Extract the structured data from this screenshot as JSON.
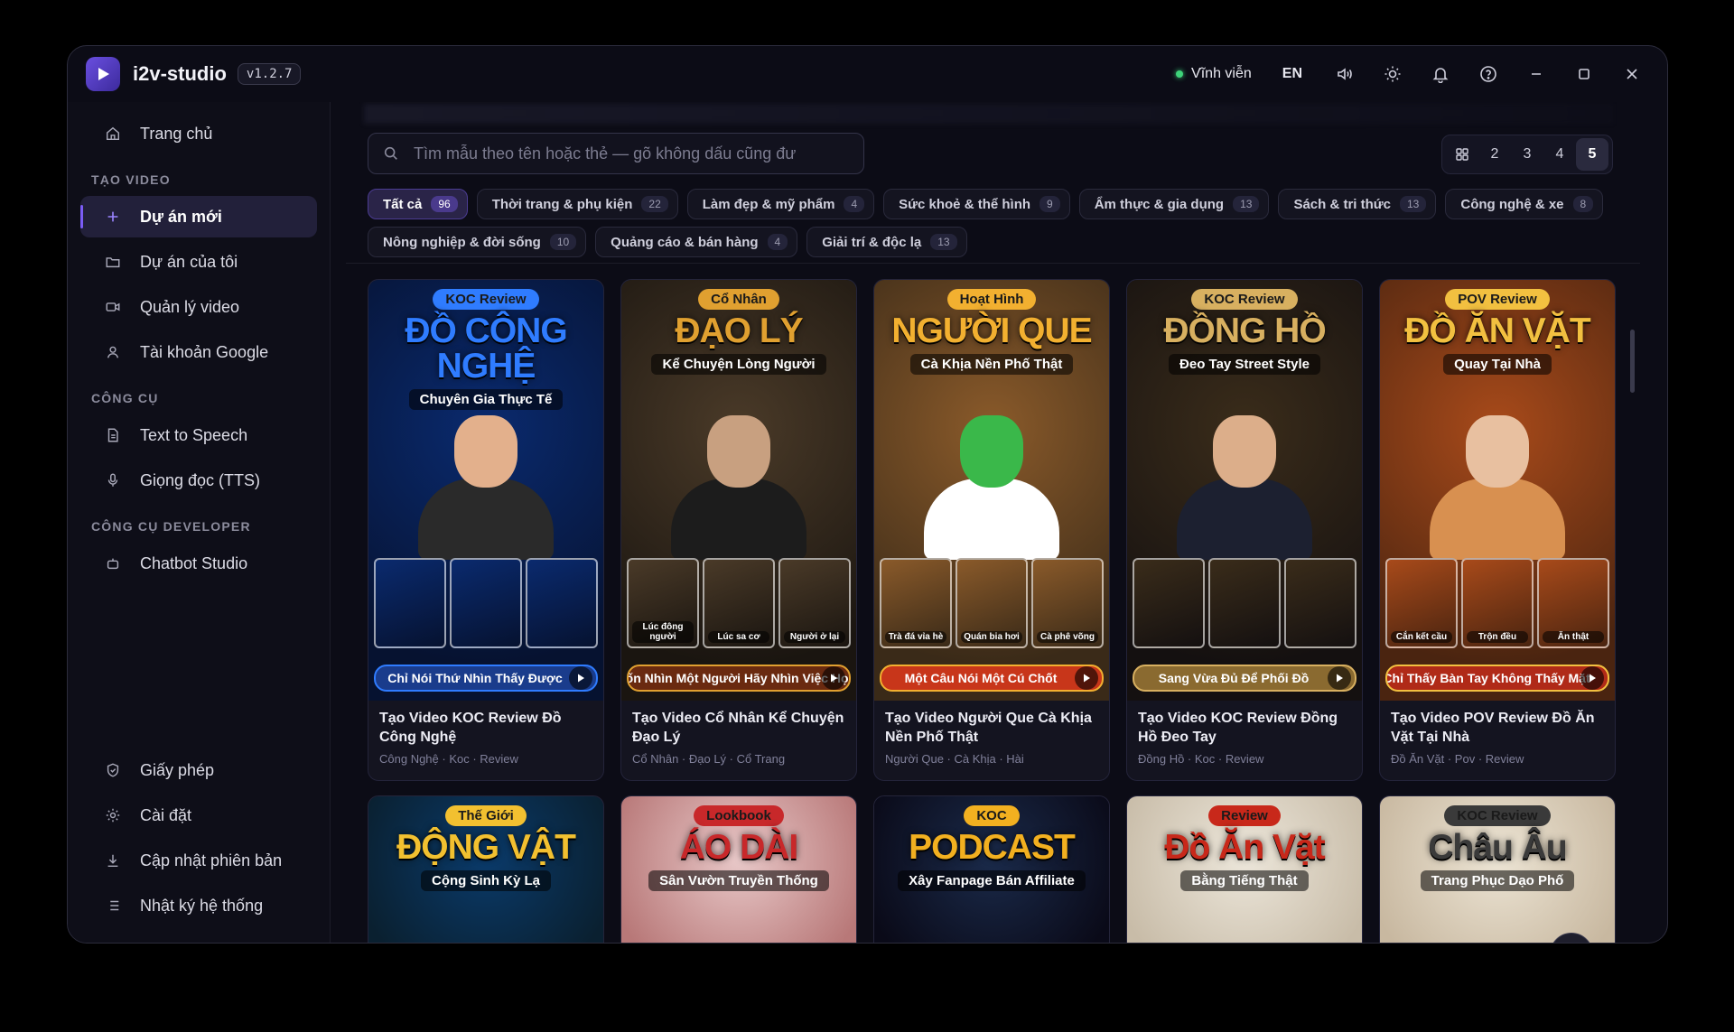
{
  "app": {
    "name": "i2v-studio",
    "version": "v1.2.7"
  },
  "titlebar": {
    "status": "Vĩnh viễn",
    "language": "EN"
  },
  "sidebar": {
    "home": "Trang chủ",
    "section_create": "TẠO VIDEO",
    "new_project": "Dự án mới",
    "my_projects": "Dự án của tôi",
    "video_manager": "Quản lý video",
    "google_account": "Tài khoản Google",
    "section_tools": "CÔNG CỤ",
    "tts": "Text to Speech",
    "voices": "Giọng đọc (TTS)",
    "section_dev": "CÔNG CỤ DEVELOPER",
    "chatbot": "Chatbot Studio",
    "license": "Giấy phép",
    "settings": "Cài đặt",
    "update": "Cập nhật phiên bản",
    "logs": "Nhật ký hệ thống"
  },
  "search": {
    "placeholder": "Tìm mẫu theo tên hoặc thẻ — gõ không dấu cũng đư"
  },
  "columns": {
    "options": [
      "2",
      "3",
      "4",
      "5"
    ],
    "selected": "5"
  },
  "filters": [
    {
      "label": "Tất cả",
      "count": "96"
    },
    {
      "label": "Thời trang & phụ kiện",
      "count": "22"
    },
    {
      "label": "Làm đẹp & mỹ phẩm",
      "count": "4"
    },
    {
      "label": "Sức khoẻ & thể hình",
      "count": "9"
    },
    {
      "label": "Ẩm thực & gia dụng",
      "count": "13"
    },
    {
      "label": "Sách & tri thức",
      "count": "13"
    },
    {
      "label": "Công nghệ & xe",
      "count": "8"
    },
    {
      "label": "Nông nghiệp & đời sống",
      "count": "10"
    },
    {
      "label": "Quảng cáo & bán hàng",
      "count": "4"
    },
    {
      "label": "Giải trí & độc lạ",
      "count": "13"
    }
  ],
  "cards": [
    {
      "title": "Tạo Video KOC Review Đồ Công Nghệ",
      "meta": "Công Nghệ · Koc · Review",
      "tag": "KOC Review",
      "big": "ĐỒ CÔNG NGHỆ",
      "sub": "Chuyên Gia Thực Tế",
      "cells": [
        "",
        "",
        ""
      ],
      "banner": "Chỉ Nói Thứ Nhìn Thấy Được",
      "colors": {
        "bg1": "#0a2a6e",
        "bg2": "#061230",
        "accent": "#2f7cff",
        "skin": "#e3b08c",
        "shirt": "#2a2a2a",
        "banner": "#1a3c8c"
      }
    },
    {
      "title": "Tạo Video Cổ Nhân Kể Chuyện Đạo Lý",
      "meta": "Cổ Nhân · Đạo Lý · Cổ Trang",
      "tag": "Cổ Nhân",
      "big": "ĐẠO LÝ",
      "sub": "Kể Chuyện Lòng Người",
      "cells": [
        "Lúc đông người",
        "Lúc sa cơ",
        "Người ở lại"
      ],
      "banner": "Muốn Nhìn Một Người Hãy Nhìn Việc Họ",
      "colors": {
        "bg1": "#4a3a28",
        "bg2": "#1a1510",
        "accent": "#e0a030",
        "skin": "#c8a080",
        "shirt": "#1c1c1c",
        "banner": "#6a2a10"
      }
    },
    {
      "title": "Tạo Video Người Que Cà Khịa Nền Phố Thật",
      "meta": "Người Que · Cà Khịa · Hài",
      "tag": "Hoạt Hình",
      "big": "NGƯỜI QUE",
      "sub": "Cà Khịa Nền Phố Thật",
      "cells": [
        "Trà đá vỉa hè",
        "Quán bia hơi",
        "Cà phê võng"
      ],
      "banner": "Một Câu Nói Một Cú Chốt",
      "colors": {
        "bg1": "#8a5a2a",
        "bg2": "#3a2a18",
        "accent": "#f2b030",
        "skin": "#3ab84a",
        "shirt": "#ffffff",
        "banner": "#c8361a"
      }
    },
    {
      "title": "Tạo Video KOC Review Đồng Hồ Đeo Tay",
      "meta": "Đồng Hồ · Koc · Review",
      "tag": "KOC Review",
      "big": "ĐỒNG HỒ",
      "sub": "Đeo Tay Street Style",
      "cells": [
        "",
        "",
        ""
      ],
      "banner": "Sang Vừa Đủ Để Phối Đồ",
      "colors": {
        "bg1": "#3a2c1a",
        "bg2": "#141010",
        "accent": "#d8b060",
        "skin": "#dcae8a",
        "shirt": "#1c2030",
        "banner": "#8a6a30"
      }
    },
    {
      "title": "Tạo Video POV Review Đồ Ăn Vặt Tại Nhà",
      "meta": "Đồ Ăn Vặt · Pov · Review",
      "tag": "POV Review",
      "big": "ĐỒ ĂN VẶT",
      "sub": "Quay Tại Nhà",
      "cells": [
        "Cắn kết cầu",
        "Trộn đều",
        "Ăn thật"
      ],
      "banner": "Chỉ Thấy Bàn Tay Không Thấy Mặt",
      "colors": {
        "bg1": "#a84a1a",
        "bg2": "#4a2410",
        "accent": "#f2c040",
        "skin": "#e8c0a0",
        "shirt": "#d89050",
        "banner": "#b02a18"
      }
    },
    {
      "tag": "Thế Giới",
      "big": "ĐỘNG VẬT",
      "sub": "Cộng Sinh Kỳ Lạ",
      "colors": {
        "bg1": "#0a3a6a",
        "bg2": "#0a2030",
        "accent": "#f2c030"
      }
    },
    {
      "tag": "Lookbook",
      "big": "ÁO DÀI",
      "sub": "Sân Vườn Truyền Thống",
      "colors": {
        "bg1": "#e8c8c8",
        "bg2": "#b87878",
        "accent": "#c8282a"
      }
    },
    {
      "tag": "KOC",
      "big": "PODCAST",
      "sub": "Xây Fanpage Bán Affiliate",
      "colors": {
        "bg1": "#1a2a4a",
        "bg2": "#0a0a18",
        "accent": "#f2b020"
      }
    },
    {
      "tag": "Review",
      "big": "Đồ Ăn Vặt",
      "sub": "Bằng Tiếng Thật",
      "colors": {
        "bg1": "#ece6da",
        "bg2": "#c8bca8",
        "accent": "#c8281a"
      }
    },
    {
      "tag": "KOC Review",
      "big": "Châu Âu",
      "sub": "Trang Phục Dạo Phố",
      "colors": {
        "bg1": "#ece4d4",
        "bg2": "#c8b8a0",
        "accent": "#3a3a3a"
      }
    }
  ]
}
